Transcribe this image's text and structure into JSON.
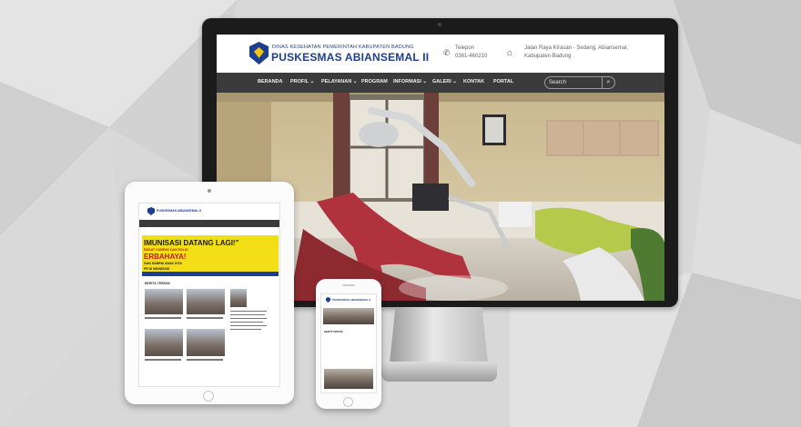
{
  "site": {
    "org_sub": "DINAS KESEHATAN PEMERINTAH KABUPATEN BADUNG",
    "org_name": "PUSKESMAS ABIANSEMAL II",
    "phone_label": "Telepon",
    "phone_number": "0361-460210",
    "address_line1": "Jalan Raya Kirasan - Sedang, Abiansemal,",
    "address_line2": "Kabupaten Badung"
  },
  "nav": {
    "items": [
      {
        "label": "BERANDA"
      },
      {
        "label": "PROFIL ⌄"
      },
      {
        "label": "PELAYANAN ⌄"
      },
      {
        "label": "PROGRAM"
      },
      {
        "label": "INFORMASI ⌄"
      },
      {
        "label": "GALERI ⌄"
      },
      {
        "label": "KONTAK"
      },
      {
        "label": "PORTAL"
      }
    ],
    "search_placeholder": "Search"
  },
  "icons": {
    "phone": "phone-icon",
    "home": "home-icon",
    "search": "search-icon",
    "logo": "shield-logo-icon"
  },
  "tablet": {
    "org_name": "PUSKESMAS ABIANSEMAL II",
    "banner_line1": "IMUNISASI DATANG LAGI!\"",
    "banner_line2": "RAKAT CAMPAK DAN POLIO",
    "banner_line3": "ERBAHAYA!",
    "banner_line4": "GAN SAMPAI ANAK KITA",
    "banner_line5": "PE DI IMUNISASI",
    "section_news": "BERITA TERKINI"
  },
  "phone": {
    "org_name": "PUSKESMAS ABIANSEMAL II",
    "section_news": "BERITA TERKINI"
  },
  "colors": {
    "brand_blue": "#1d3f8f",
    "nav_bg": "#3b3b3b",
    "banner_yellow": "#f4de18"
  }
}
